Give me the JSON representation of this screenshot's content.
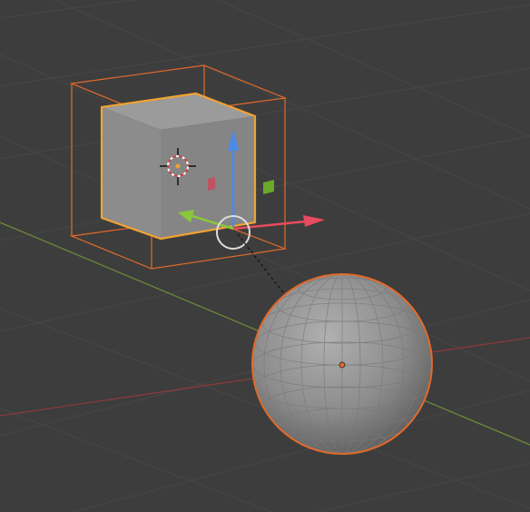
{
  "viewport": {
    "background": "#3d3d3d",
    "grid_color": "#474747",
    "x_axis_color": "#8a3a3a",
    "y_axis_color": "#6b8a3a"
  },
  "cube": {
    "name_icon": "cube-mesh",
    "face_front": "#8d8d8d",
    "face_top": "#9a9a9a",
    "face_side": "#838383",
    "outline_color": "#f0a232",
    "bounds_color": "#e36a2a"
  },
  "sphere": {
    "name_icon": "uv-sphere-mesh",
    "fill": "#8f8f8f",
    "outline_color": "#e36a2a",
    "origin_color": "#e36a2a"
  },
  "gizmo": {
    "z_color": "#4a8ae8",
    "x_color": "#e84a5f",
    "y_color": "#8ac83a",
    "rotate_circle_color": "#dddddd",
    "plane_handle_xz": "#c84a5a",
    "plane_handle_yz": "#6aa82a"
  },
  "cursor_3d": {
    "icon": "3d-cursor-icon",
    "ring_color": "#d04040"
  }
}
